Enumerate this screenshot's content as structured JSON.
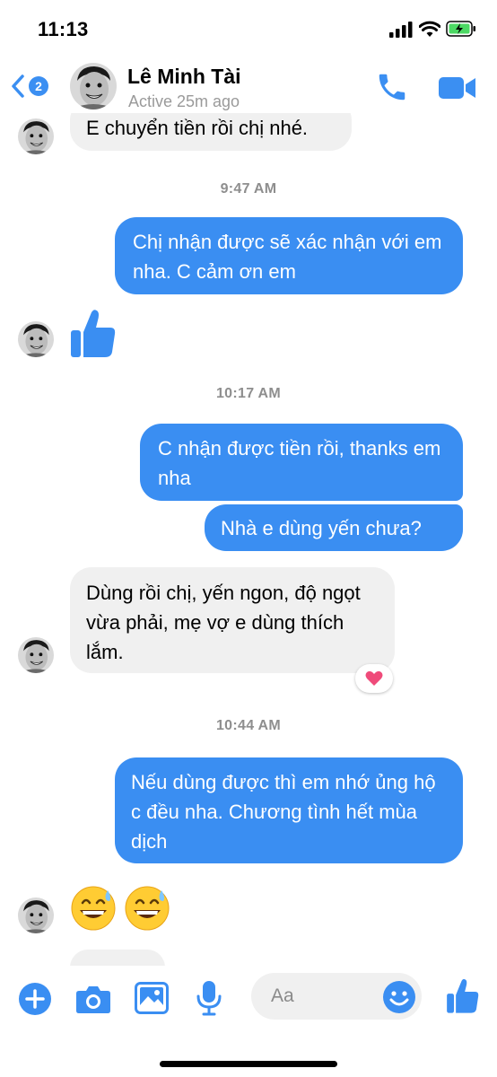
{
  "status_bar": {
    "time": "11:13"
  },
  "header": {
    "back_badge": "2",
    "contact_name": "Lê Minh Tài",
    "contact_status": "Active 25m ago",
    "icons": {
      "back": "chevron-left-icon",
      "call": "phone-icon",
      "video": "video-camera-icon"
    }
  },
  "messages": [
    {
      "type": "incoming",
      "text": "E chuyển tiền rồi chị nhé."
    },
    {
      "type": "timestamp",
      "text": "9:47 AM"
    },
    {
      "type": "outgoing",
      "text": "Chị nhận được sẽ xác nhận với em nha. C cảm ơn em"
    },
    {
      "type": "incoming-like",
      "icon": "thumbs-up-icon"
    },
    {
      "type": "timestamp",
      "text": "10:17 AM"
    },
    {
      "type": "outgoing",
      "text": "C nhận được tiền rồi, thanks em nha"
    },
    {
      "type": "outgoing",
      "text": "Nhà e dùng yến chưa?"
    },
    {
      "type": "incoming",
      "text": "Dùng rồi chị, yến ngon, độ ngọt vừa phải, mẹ vợ e dùng thích lắm.",
      "reaction": "heart-icon"
    },
    {
      "type": "timestamp",
      "text": "10:44 AM"
    },
    {
      "type": "outgoing",
      "text": "Nếu dùng được thì em nhớ ủng hộ c đều nha. Chương tình hết mùa dịch"
    },
    {
      "type": "incoming-emoji",
      "text": "😅 😅"
    }
  ],
  "composer": {
    "placeholder": "Aa",
    "icons": [
      "plus-icon",
      "camera-icon",
      "image-icon",
      "microphone-icon",
      "smiley-icon",
      "thumbs-up-icon"
    ]
  },
  "colors": {
    "accent": "#3a8ef2",
    "incoming_bubble": "#f0f0f0",
    "timestamp": "#8e8e8e",
    "reaction": "#ef4b7a"
  }
}
